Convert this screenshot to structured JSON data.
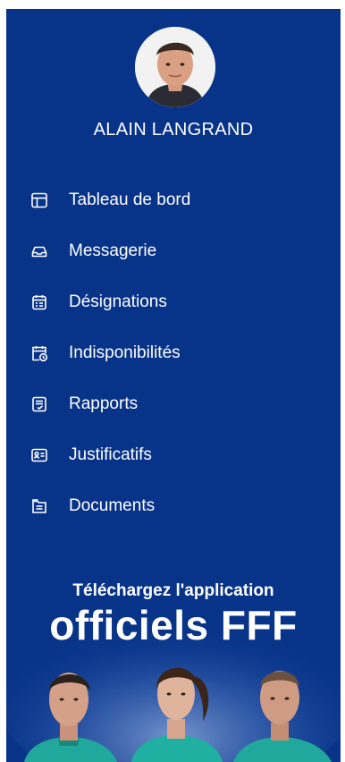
{
  "user": {
    "name": "ALAIN LANGRAND"
  },
  "menu": {
    "items": [
      {
        "label": "Tableau de bord",
        "icon": "dashboard-icon"
      },
      {
        "label": "Messagerie",
        "icon": "inbox-icon"
      },
      {
        "label": "Désignations",
        "icon": "assignments-icon"
      },
      {
        "label": "Indisponibilités",
        "icon": "calendar-clock-icon"
      },
      {
        "label": "Rapports",
        "icon": "report-check-icon"
      },
      {
        "label": "Justificatifs",
        "icon": "id-card-icon"
      },
      {
        "label": "Documents",
        "icon": "document-icon"
      }
    ]
  },
  "promo": {
    "subtitle": "Téléchargez l'application",
    "title": "officiels FFF"
  },
  "colors": {
    "sidebar_bg": "#073388",
    "text": "#ffffff"
  }
}
